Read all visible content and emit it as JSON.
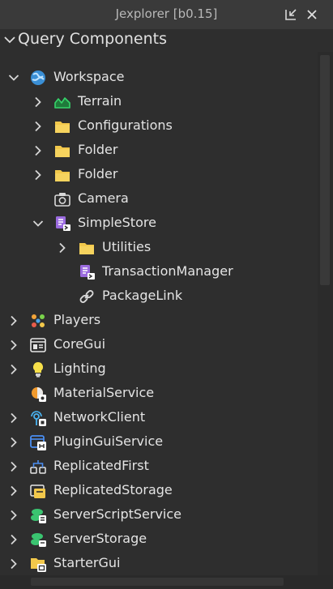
{
  "window": {
    "title": "Jexplorer [b0.15]"
  },
  "query": {
    "label": "Query Components"
  },
  "tree": [
    {
      "label": "Workspace",
      "icon": "workspace-icon",
      "expander": "expanded",
      "depth": 0
    },
    {
      "label": "Terrain",
      "icon": "terrain-icon",
      "expander": "collapsed",
      "depth": 1
    },
    {
      "label": "Configurations",
      "icon": "folder-icon",
      "expander": "collapsed",
      "depth": 1
    },
    {
      "label": "Folder",
      "icon": "folder-icon",
      "expander": "collapsed",
      "depth": 1
    },
    {
      "label": "Folder",
      "icon": "folder-icon",
      "expander": "collapsed",
      "depth": 1
    },
    {
      "label": "Camera",
      "icon": "camera-icon",
      "expander": "none",
      "depth": 1
    },
    {
      "label": "SimpleStore",
      "icon": "package-script-icon",
      "expander": "expanded",
      "depth": 1
    },
    {
      "label": "Utilities",
      "icon": "folder-icon",
      "expander": "collapsed",
      "depth": 2
    },
    {
      "label": "TransactionManager",
      "icon": "package-script-icon",
      "expander": "none",
      "depth": 2
    },
    {
      "label": "PackageLink",
      "icon": "link-icon",
      "expander": "none",
      "depth": 2
    },
    {
      "label": "Players",
      "icon": "players-icon",
      "expander": "collapsed",
      "depth": 0
    },
    {
      "label": "CoreGui",
      "icon": "coregui-icon",
      "expander": "collapsed",
      "depth": 0
    },
    {
      "label": "Lighting",
      "icon": "lightbulb-icon",
      "expander": "collapsed",
      "depth": 0
    },
    {
      "label": "MaterialService",
      "icon": "material-service-icon",
      "expander": "none",
      "depth": 0
    },
    {
      "label": "NetworkClient",
      "icon": "network-client-icon",
      "expander": "collapsed",
      "depth": 0
    },
    {
      "label": "PluginGuiService",
      "icon": "plugin-gui-service-icon",
      "expander": "collapsed",
      "depth": 0
    },
    {
      "label": "ReplicatedFirst",
      "icon": "replicated-first-icon",
      "expander": "collapsed",
      "depth": 0
    },
    {
      "label": "ReplicatedStorage",
      "icon": "replicated-storage-icon",
      "expander": "collapsed",
      "depth": 0
    },
    {
      "label": "ServerScriptService",
      "icon": "server-script-service-icon",
      "expander": "collapsed",
      "depth": 0
    },
    {
      "label": "ServerStorage",
      "icon": "server-storage-icon",
      "expander": "collapsed",
      "depth": 0
    },
    {
      "label": "StarterGui",
      "icon": "starter-gui-icon",
      "expander": "collapsed",
      "depth": 0
    }
  ],
  "colors": {
    "background": "#2e2e2e",
    "titlebar": "#3a3a3a",
    "text": "#e4e4e4",
    "folder": "#f2c84b",
    "script_purple": "#9b6bdf",
    "terrain_green": "#2fbf5a"
  }
}
